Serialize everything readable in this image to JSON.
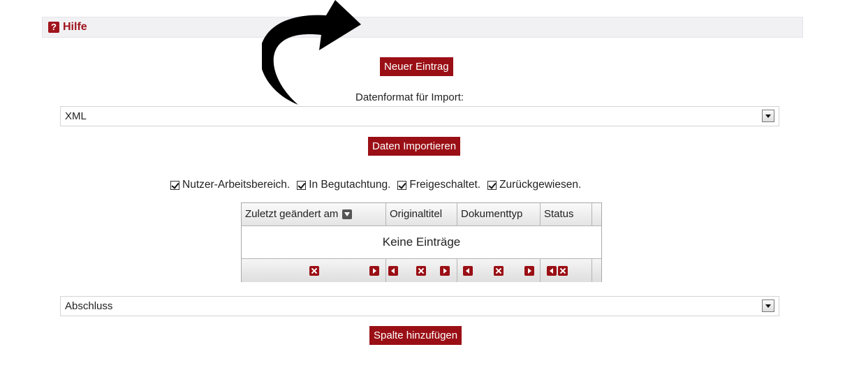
{
  "help": {
    "label": "Hilfe",
    "icon": "question-mark-icon"
  },
  "new_entry_button": "Neuer Eintrag",
  "import_format": {
    "label": "Datenformat für Import:",
    "selected": "XML"
  },
  "import_button": "Daten Importieren",
  "filters": [
    {
      "label": "Nutzer-Arbeitsbereich.",
      "checked": true
    },
    {
      "label": "In Begutachtung.",
      "checked": true
    },
    {
      "label": "Freigeschaltet.",
      "checked": true
    },
    {
      "label": "Zurückgewiesen.",
      "checked": true
    }
  ],
  "table": {
    "columns": [
      "Zuletzt geändert am",
      "Originaltitel",
      "Dokumenttyp",
      "Status"
    ],
    "empty_message": "Keine Einträge"
  },
  "column_select": {
    "selected": "Abschluss"
  },
  "add_column_button": "Spalte hinzufügen",
  "colors": {
    "accent": "#9a0f15",
    "header_bg": "#f1f1f4"
  }
}
